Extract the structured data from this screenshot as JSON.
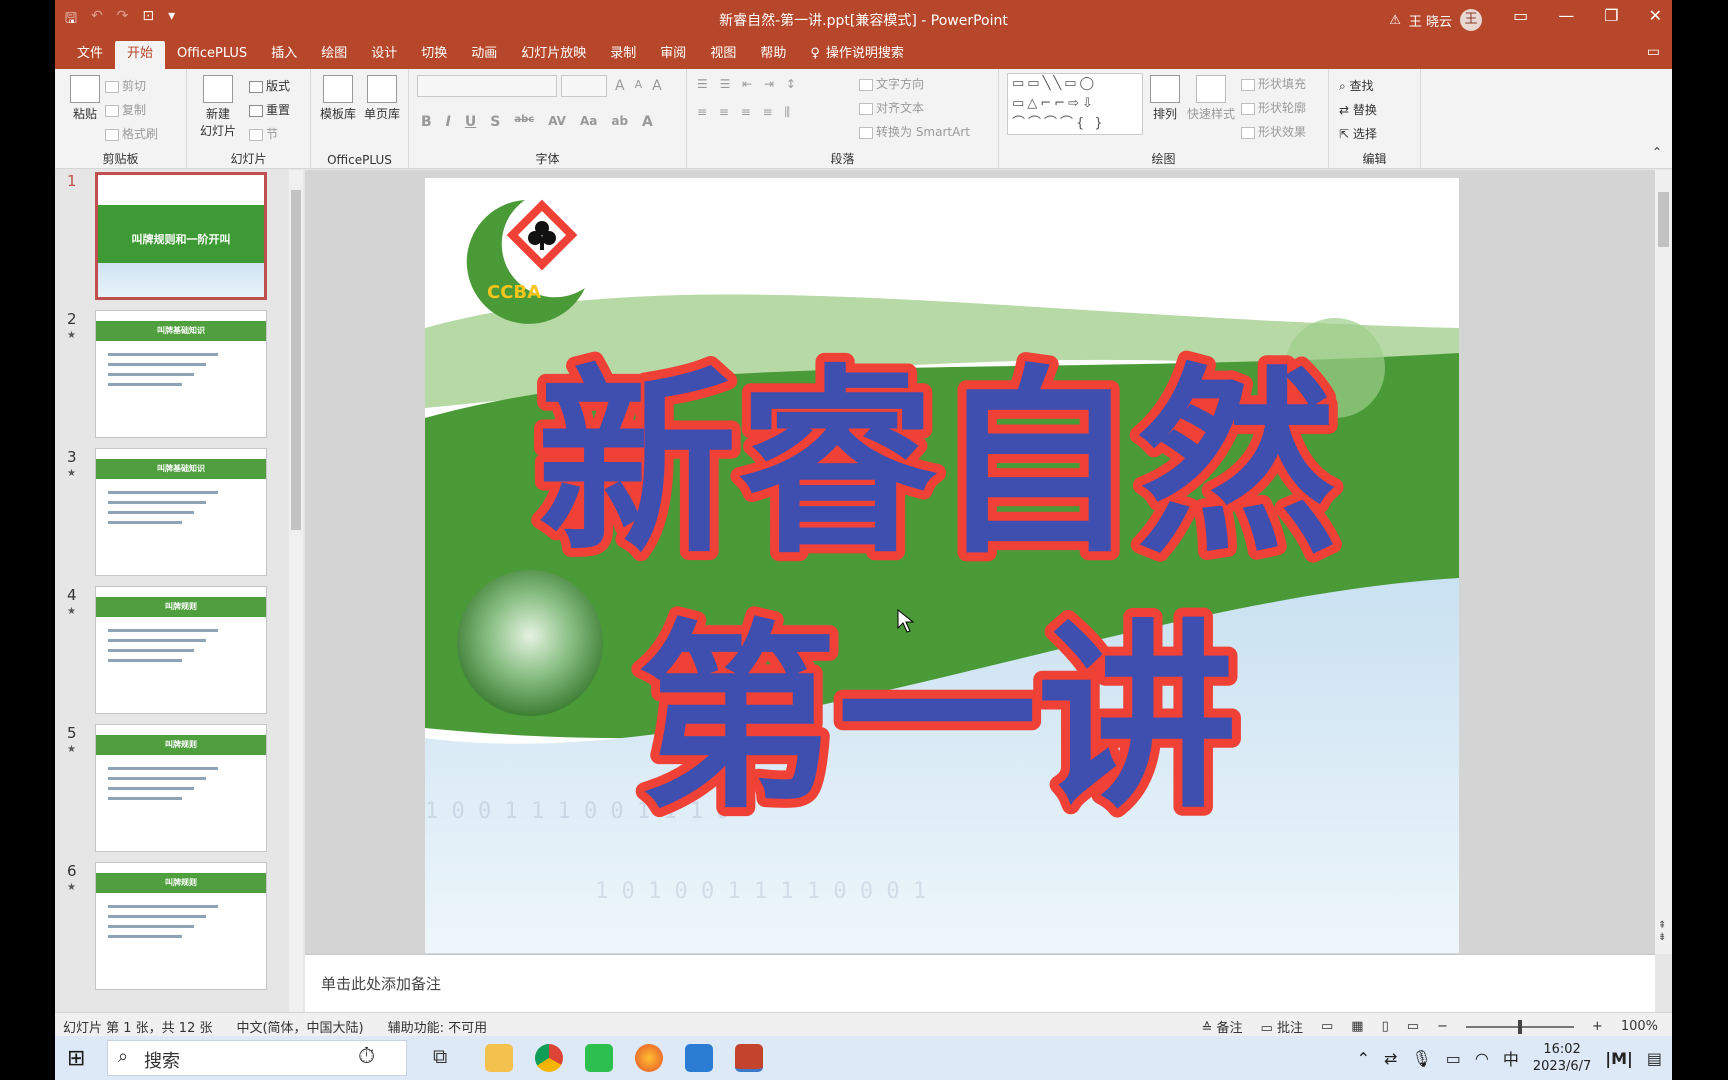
{
  "window": {
    "title": "新睿自然-第一讲.ppt[兼容模式] - PowerPoint",
    "user_name": "王 晓云",
    "user_initial": "王",
    "warning_icon": "⚠",
    "min_icon": "—",
    "max_icon": "❐",
    "close_icon": "✕",
    "ribbon_display_icon": "▭"
  },
  "qat": {
    "save": "🖫",
    "undo": "↶",
    "redo": "↷",
    "present": "⊡",
    "more": "▾"
  },
  "tabs": [
    "文件",
    "开始",
    "OfficePLUS",
    "插入",
    "绘图",
    "设计",
    "切换",
    "动画",
    "幻灯片放映",
    "录制",
    "审阅",
    "视图",
    "帮助"
  ],
  "active_tab": "开始",
  "tell_me": "操作说明搜索",
  "tell_me_icon": "♀",
  "ribbon": {
    "clipboard": {
      "paste": "粘贴",
      "cut": "剪切",
      "copy": "复制",
      "format_painter": "格式刷",
      "label": "剪贴板"
    },
    "slides": {
      "new_slide": "新建",
      "new_slide2": "幻灯片",
      "layout": "版式",
      "reset": "重置",
      "section": "节",
      "label": "幻灯片"
    },
    "officeplus": {
      "templates": "模板库",
      "single_page": "单页库",
      "label": "OfficePLUS"
    },
    "font": {
      "label": "字体",
      "bold": "B",
      "italic": "I",
      "underline": "U",
      "shadow": "S",
      "strike": "abc",
      "spacing": "AV",
      "case": "Aa",
      "highlight": "ab",
      "color": "A",
      "grow": "A",
      "shrink": "A",
      "clear": "A"
    },
    "paragraph": {
      "label": "段落",
      "text_dir": "文字方向",
      "align_text": "对齐文本",
      "smartart": "转换为 SmartArt"
    },
    "drawing": {
      "label": "绘图",
      "arrange": "排列",
      "quick_styles": "快速样式",
      "fill": "形状填充",
      "outline": "形状轮廓",
      "effects": "形状效果"
    },
    "editing": {
      "label": "编辑",
      "find": "查找",
      "replace": "替换",
      "select": "选择"
    }
  },
  "thumbnails": [
    {
      "num": "1",
      "star": "",
      "title": "叫牌规则和一阶开叫"
    },
    {
      "num": "2",
      "star": "★",
      "title": "叫牌基础知识"
    },
    {
      "num": "3",
      "star": "★",
      "title": "叫牌基础知识"
    },
    {
      "num": "4",
      "star": "★",
      "title": "叫牌规则"
    },
    {
      "num": "5",
      "star": "★",
      "title": "叫牌规则"
    },
    {
      "num": "6",
      "star": "★",
      "title": "叫牌规则"
    }
  ],
  "slide": {
    "logo_text": "CCBA",
    "title_line1": "新睿自然",
    "title_line2": "第一讲",
    "colors": {
      "outline": "#ef4136",
      "fill": "#3f4fb0",
      "green": "#4a9a37"
    }
  },
  "notes_placeholder": "单击此处添加备注",
  "status": {
    "slide_info": "幻灯片 第 1 张，共 12 张",
    "language": "中文(简体，中国大陆)",
    "accessibility": "辅助功能: 不可用",
    "notes": "备注",
    "comments": "批注",
    "zoom": "100%"
  },
  "taskbar": {
    "search": "搜索",
    "ime": "中",
    "time": "16:02",
    "date": "2023/6/7"
  }
}
